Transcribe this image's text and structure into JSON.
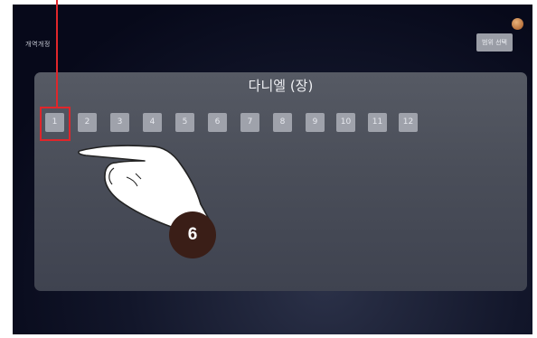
{
  "screen": {
    "top_left_label": "개역개정",
    "top_right_button": "범위 선택"
  },
  "panel": {
    "title": "다니엘 (장)",
    "chapters": [
      "1",
      "2",
      "3",
      "4",
      "5",
      "6",
      "7",
      "8",
      "9",
      "10",
      "11",
      "12"
    ],
    "selected_chapter": "1"
  },
  "annotation": {
    "step_number": "6",
    "highlight_color": "#e0262b"
  },
  "colors": {
    "panel_bg": "#4e525d",
    "chip_bg": "#9fa2ab",
    "badge_bg": "#3a1e17"
  }
}
